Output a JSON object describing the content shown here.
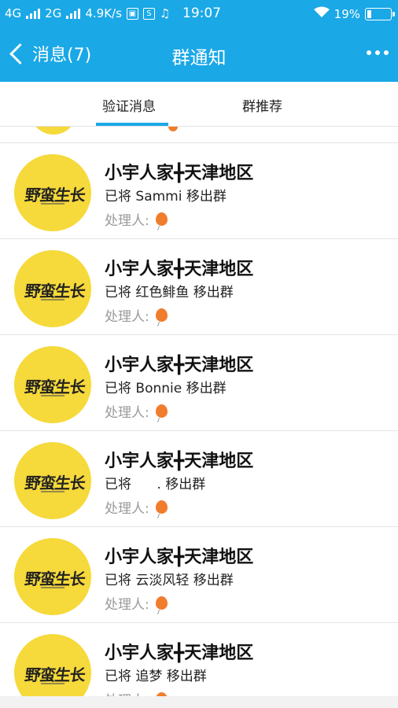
{
  "status_bar": {
    "network1": "4G",
    "network2": "2G",
    "speed": "4.9K/s",
    "time": "19:07",
    "battery_percent": "19%",
    "battery_level": 0.19
  },
  "header": {
    "back_label": "消息(7)",
    "title": "群通知"
  },
  "tabs": [
    {
      "label": "验证消息",
      "active": true
    },
    {
      "label": "群推荐",
      "active": false
    }
  ],
  "avatar_logo_text": "野蛮生长",
  "handler_label": "处理人:",
  "notifications": [
    {
      "group": "小宇人家╋天津地区",
      "action": "已将 Sammi 移出群"
    },
    {
      "group": "小宇人家╋天津地区",
      "action": "已将 红色鲱鱼 移出群"
    },
    {
      "group": "小宇人家╋天津地区",
      "action": "已将 Bonnie 移出群"
    },
    {
      "group": "小宇人家╋天津地区",
      "action": "已将      . 移出群"
    },
    {
      "group": "小宇人家╋天津地区",
      "action": "已将 云淡风轻 移出群"
    },
    {
      "group": "小宇人家╋天津地区",
      "action": "已将 追梦 移出群"
    }
  ],
  "colors": {
    "primary": "#1aa8e6",
    "avatar_bg": "#f6d93a",
    "balloon": "#f07d2c"
  }
}
